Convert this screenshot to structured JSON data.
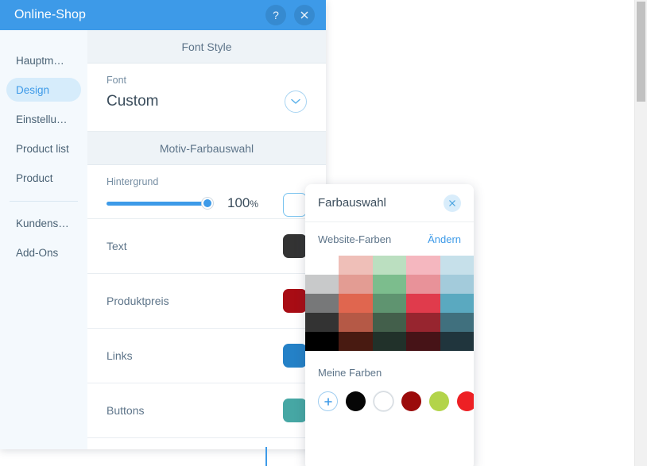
{
  "window": {
    "title": "Online-Shop",
    "help_icon": "question-mark-icon",
    "close_icon": "close-icon",
    "header_color": "#3d9ae8"
  },
  "sidebar": {
    "items": [
      {
        "label": "Hauptm…",
        "active": false
      },
      {
        "label": "Design",
        "active": true
      },
      {
        "label": "Einstellu…",
        "active": false
      },
      {
        "label": "Product list",
        "active": false
      },
      {
        "label": "Product",
        "active": false
      }
    ],
    "items_after_separator": [
      {
        "label": "Kundens…",
        "active": false
      },
      {
        "label": "Add-Ons",
        "active": false
      }
    ],
    "active_color": "#3d9ae8",
    "active_background": "#d6ecfb"
  },
  "main": {
    "font_section": {
      "header": "Font Style",
      "field_label": "Font",
      "field_value": "Custom",
      "chevron_icon": "chevron-down-icon"
    },
    "color_section": {
      "header": "Motiv-Farbauswahl",
      "background_row": {
        "label": "Hintergrund",
        "opacity_value": "100",
        "opacity_unit": "%",
        "slider_percent": 100,
        "swatch_color": "#ffffff",
        "swatch_outlined": true
      },
      "rows": [
        {
          "label": "Text",
          "color": "#333333"
        },
        {
          "label": "Produktpreis",
          "color": "#a80c14"
        },
        {
          "label": "Links",
          "color": "#2481c7"
        },
        {
          "label": "Buttons",
          "color": "#46a7a4"
        }
      ]
    }
  },
  "color_picker": {
    "title": "Farbauswahl",
    "close_icon": "close-icon",
    "website_colors_label": "Website-Farben",
    "change_link": "Ändern",
    "swatch_grid": [
      [
        "#ffffff",
        "#efbfb8",
        "#bbdfc0",
        "#f5b7bf",
        "#c6e0ea"
      ],
      [
        "#c8c9ca",
        "#e39c93",
        "#7cbd8d",
        "#e89299",
        "#a3cbdb"
      ],
      [
        "#777879",
        "#e0664f",
        "#5f9470",
        "#e03b4c",
        "#5aa9c0"
      ],
      [
        "#333333",
        "#b55946",
        "#435f4b",
        "#97252f",
        "#40707e"
      ],
      [
        "#000000",
        "#481a11",
        "#21312a",
        "#461317",
        "#20353d"
      ]
    ],
    "my_colors_label": "Meine Farben",
    "my_colors": [
      {
        "type": "add",
        "icon": "plus-icon",
        "color": "#ffffff"
      },
      {
        "type": "swatch",
        "color": "#060606"
      },
      {
        "type": "swatch",
        "color": "#ffffff"
      },
      {
        "type": "swatch",
        "color": "#9b0b0b"
      },
      {
        "type": "swatch",
        "color": "#b3d44a"
      },
      {
        "type": "swatch",
        "color": "#ed2024"
      }
    ]
  }
}
